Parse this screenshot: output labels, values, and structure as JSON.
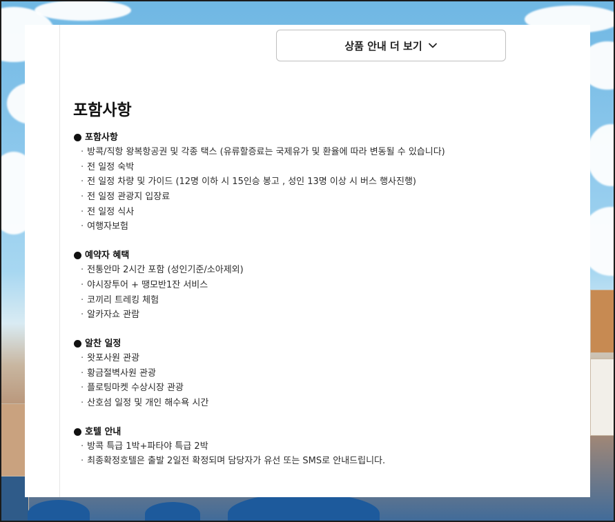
{
  "more_button": {
    "label": "상품 안내 더 보기"
  },
  "section_title": "포함사항",
  "groups": [
    {
      "title": "포함사항",
      "items": [
        "방콕/직항 왕복항공권 및 각종 택스 (유류할증료는 국제유가 및 환율에 따라 변동될 수 있습니다)",
        "전 일정 숙박",
        "전 일정 차량 및 가이드 (12명 이하 시 15인승 봉고 , 성인 13명 이상 시 버스 행사진행)",
        "전 일정 관광지 입장료",
        "전 일정 식사",
        "여행자보험"
      ]
    },
    {
      "title": "예약자 혜택",
      "items": [
        "전통안마 2시간 포함 (성인기준/소아제외)",
        "야시장투어 + 땡모반1잔 서비스",
        "코끼리 트레킹 체험",
        "알카자쇼 관람"
      ]
    },
    {
      "title": "알찬 일정",
      "items": [
        "왓포사원 관광",
        "황금절벽사원 관광",
        "플로팅마켓 수상시장 관광",
        "산호섬 일정 및 개인 해수욕 시간"
      ]
    },
    {
      "title": "호텔 안내",
      "items": [
        "방콕 특급 1박+파타야 특급 2박",
        "최종확정호텔은 출발 2일전 확정되며 담당자가 유선 또는 SMS로 안내드립니다."
      ]
    }
  ],
  "icons": {
    "more_button_icon": "chevron-down-icon",
    "group_bullet": "filled-circle"
  }
}
